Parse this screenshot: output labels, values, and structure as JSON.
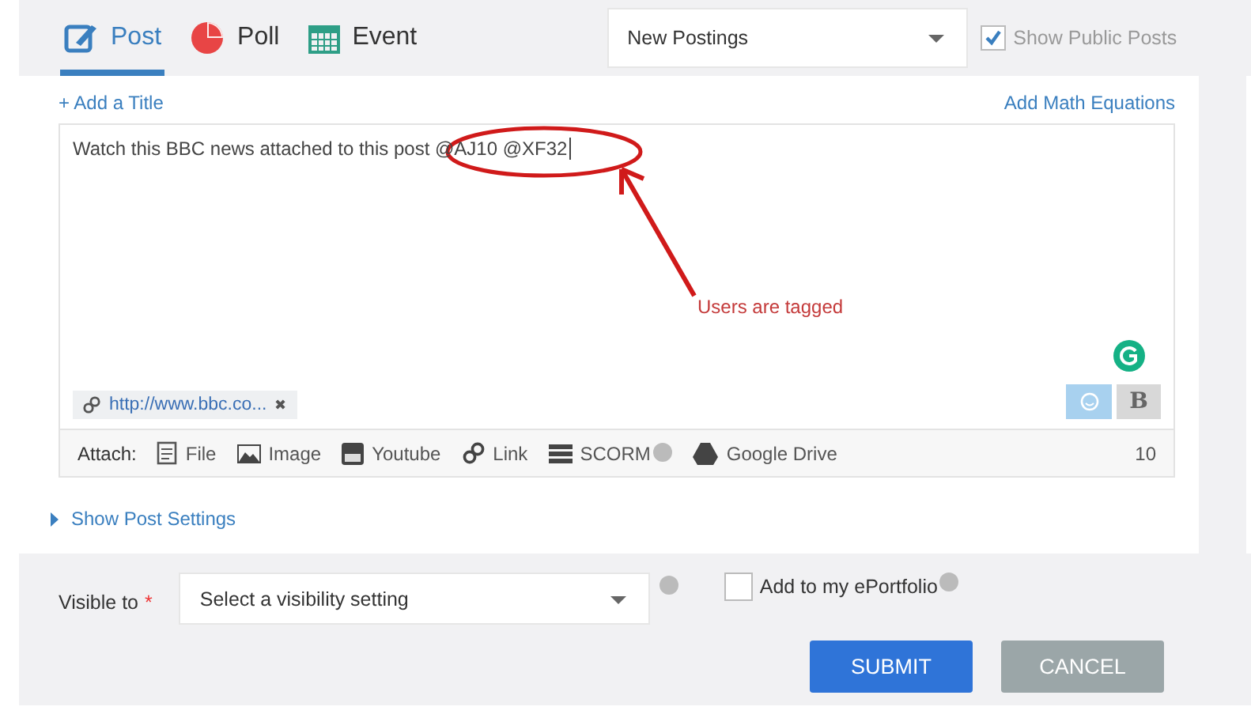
{
  "tabs": [
    {
      "kind": "post",
      "label": "Post",
      "selected": true
    },
    {
      "kind": "poll",
      "label": "Poll",
      "selected": false
    },
    {
      "kind": "event",
      "label": "Event",
      "selected": false
    }
  ],
  "sort_select": {
    "value": "New Postings"
  },
  "public_posts": {
    "label": "Show Public Posts",
    "checked": true
  },
  "composer": {
    "add_title": "+ Add a Title",
    "add_math": "Add Math Equations",
    "message": "Watch this BBC news attached to this post @AJ10 @XF32",
    "annotation": "Users are tagged",
    "link_chip": {
      "url": "http://www.bbc.co...",
      "remove": "✖"
    },
    "bold_button": "B",
    "attach_label": "Attach:",
    "attachments": [
      {
        "kind": "file",
        "label": "File",
        "info": false
      },
      {
        "kind": "image",
        "label": "Image",
        "info": false
      },
      {
        "kind": "youtube",
        "label": "Youtube",
        "info": false
      },
      {
        "kind": "link",
        "label": "Link",
        "info": false
      },
      {
        "kind": "scorm",
        "label": "SCORM",
        "info": true
      },
      {
        "kind": "drive",
        "label": "Google Drive",
        "info": false
      }
    ],
    "count": "10"
  },
  "post_settings": {
    "label": "Show Post Settings",
    "expanded": false
  },
  "visibility": {
    "label": "Visible to",
    "required_mark": "*",
    "value": "Select a visibility setting"
  },
  "eportfolio": {
    "label": "Add to my ePortfolio",
    "checked": false
  },
  "buttons": [
    {
      "kind": "submit",
      "label": "SUBMIT"
    },
    {
      "kind": "cancel",
      "label": "CANCEL"
    }
  ]
}
